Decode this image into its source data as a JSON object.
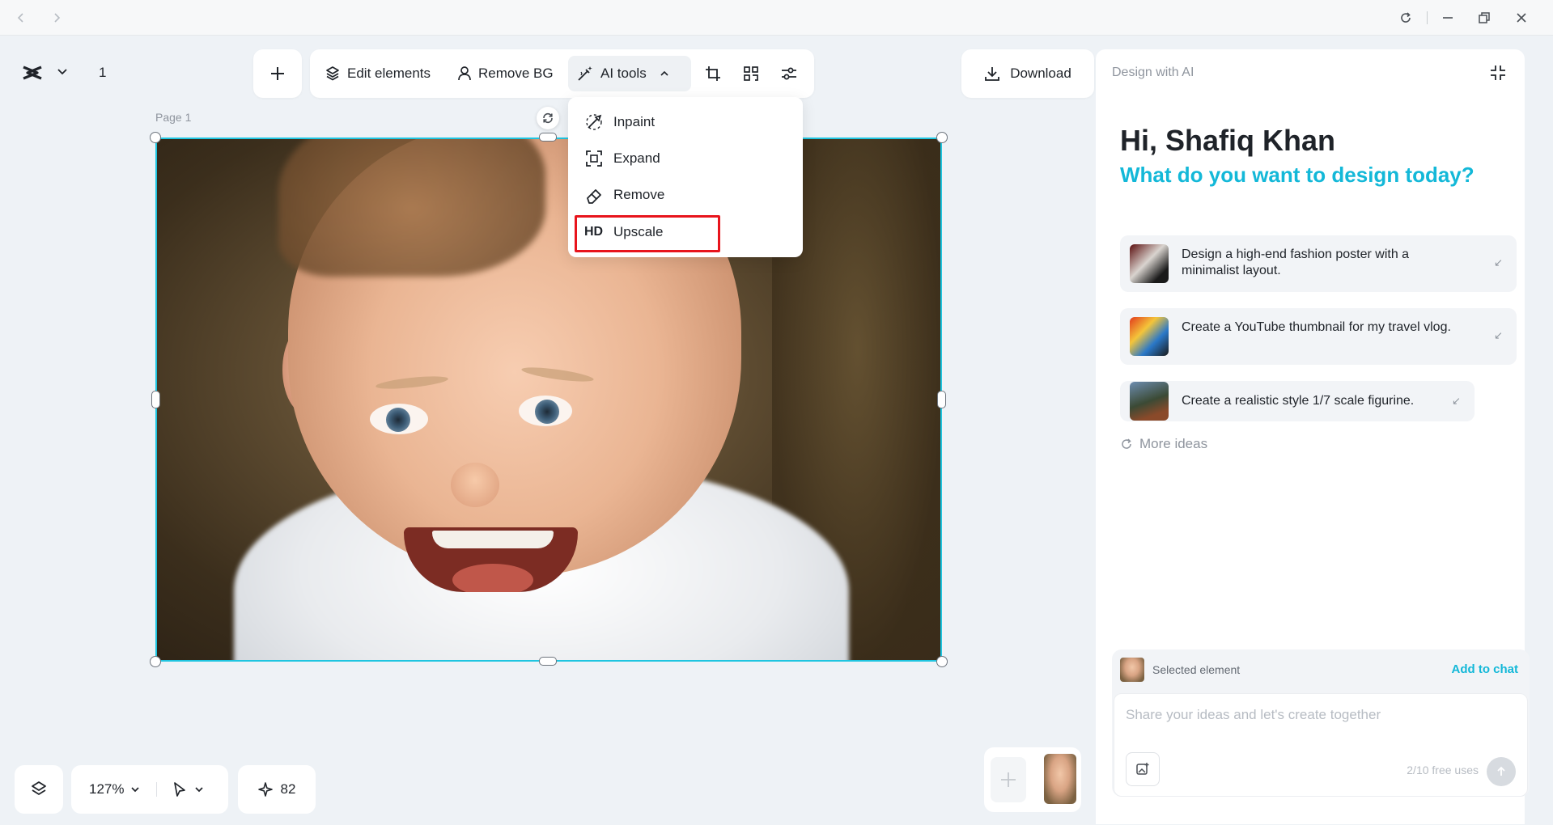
{
  "window": {
    "back_icon": "chevron-left-icon",
    "forward_icon": "chevron-right-icon",
    "reload_icon": "reload-icon",
    "minimize_icon": "minimize-icon",
    "restore_icon": "restore-icon",
    "close_icon": "close-icon"
  },
  "project": {
    "page_count": "1"
  },
  "toolbar": {
    "edit_elements": "Edit elements",
    "remove_bg": "Remove BG",
    "ai_tools": "AI tools",
    "download": "Download"
  },
  "ai_tools_menu": {
    "items": [
      {
        "label": "Inpaint",
        "icon": "inpaint-brush-icon"
      },
      {
        "label": "Expand",
        "icon": "expand-frame-icon"
      },
      {
        "label": "Remove",
        "icon": "eraser-icon"
      },
      {
        "label": "Upscale",
        "icon": "hd-badge-icon",
        "badge": "HD",
        "highlighted": true
      }
    ]
  },
  "canvas": {
    "page_label": "Page 1"
  },
  "bottom_bar": {
    "zoom": "127%",
    "credits": "82"
  },
  "ai_panel": {
    "header": "Design with AI",
    "greeting": "Hi, Shafiq Khan",
    "subheading": "What do you want to design today?",
    "ideas": [
      {
        "text": "Design a high-end fashion poster with a minimalist layout."
      },
      {
        "text": "Create a YouTube thumbnail for my travel vlog."
      },
      {
        "text": "Create a realistic style 1/7 scale figurine."
      }
    ],
    "more_ideas": "More ideas",
    "selected_element": "Selected element",
    "add_to_chat": "Add to chat",
    "chat_placeholder": "Share your ideas and let's create together",
    "free_uses": "2/10 free uses"
  },
  "colors": {
    "accent": "#13b8d8",
    "selection": "#1fc5e0",
    "highlight": "#e8141c"
  }
}
